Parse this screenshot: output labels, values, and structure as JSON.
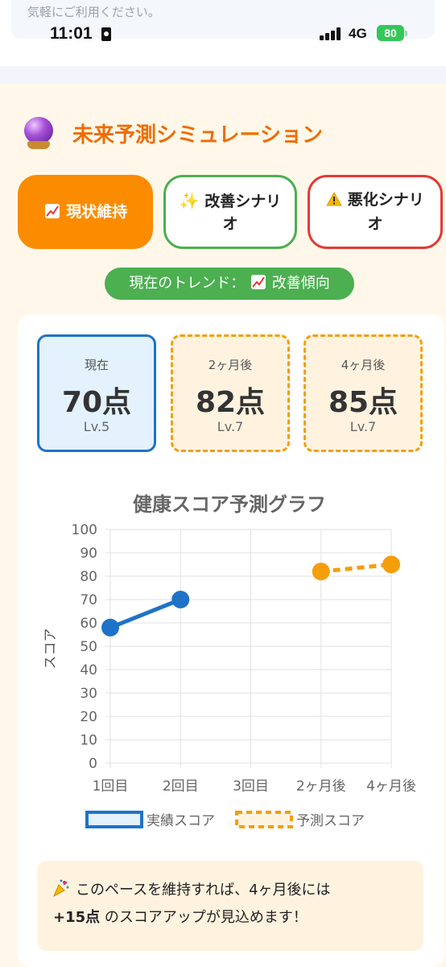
{
  "top_hint": "気軽にご利用ください。",
  "status_bar": {
    "time": "11:01",
    "network": "4G",
    "battery": "80"
  },
  "section": {
    "title": "未来予測シミュレーション",
    "icon": "crystal-ball-icon"
  },
  "scenarios": [
    {
      "label": "現状維持",
      "icon": "chart-up-icon",
      "selected": true
    },
    {
      "label": "改善シナリオ",
      "icon": "sparkles-icon",
      "selected": false
    },
    {
      "label": "悪化シナリオ",
      "icon": "warning-icon",
      "selected": false
    }
  ],
  "trend": {
    "prefix": "現在のトレンド：",
    "value": "改善傾向"
  },
  "scores": [
    {
      "label": "現在",
      "value": "70点",
      "level": "Lv.5"
    },
    {
      "label": "2ヶ月後",
      "value": "82点",
      "level": "Lv.7"
    },
    {
      "label": "4ヶ月後",
      "value": "85点",
      "level": "Lv.7"
    }
  ],
  "chart_data": {
    "type": "line",
    "title": "健康スコア予測グラフ",
    "xlabel": "",
    "ylabel": "スコア",
    "categories": [
      "1回目",
      "2回目",
      "3回目",
      "2ヶ月後",
      "4ヶ月後"
    ],
    "ylim": [
      0,
      100
    ],
    "yticks": [
      0,
      10,
      20,
      30,
      40,
      50,
      60,
      70,
      80,
      90,
      100
    ],
    "grid": true,
    "legend_position": "bottom",
    "series": [
      {
        "name": "実績スコア",
        "color": "#1e73c8",
        "style": "solid",
        "values": [
          58,
          70,
          null,
          null,
          null
        ]
      },
      {
        "name": "予測スコア",
        "color": "#f59e0b",
        "style": "dashed",
        "values": [
          null,
          null,
          null,
          82,
          85
        ]
      }
    ]
  },
  "message": {
    "line1": "このペースを維持すれば、4ヶ月後には",
    "highlight": "+15点",
    "line2": " のスコアアップが見込めます！",
    "icon": "party-popper-icon"
  },
  "colors": {
    "accent_orange": "#fb8c00",
    "title_orange": "#ef6c00",
    "green": "#4caf50",
    "red": "#e53935",
    "blue": "#1e73c8"
  }
}
